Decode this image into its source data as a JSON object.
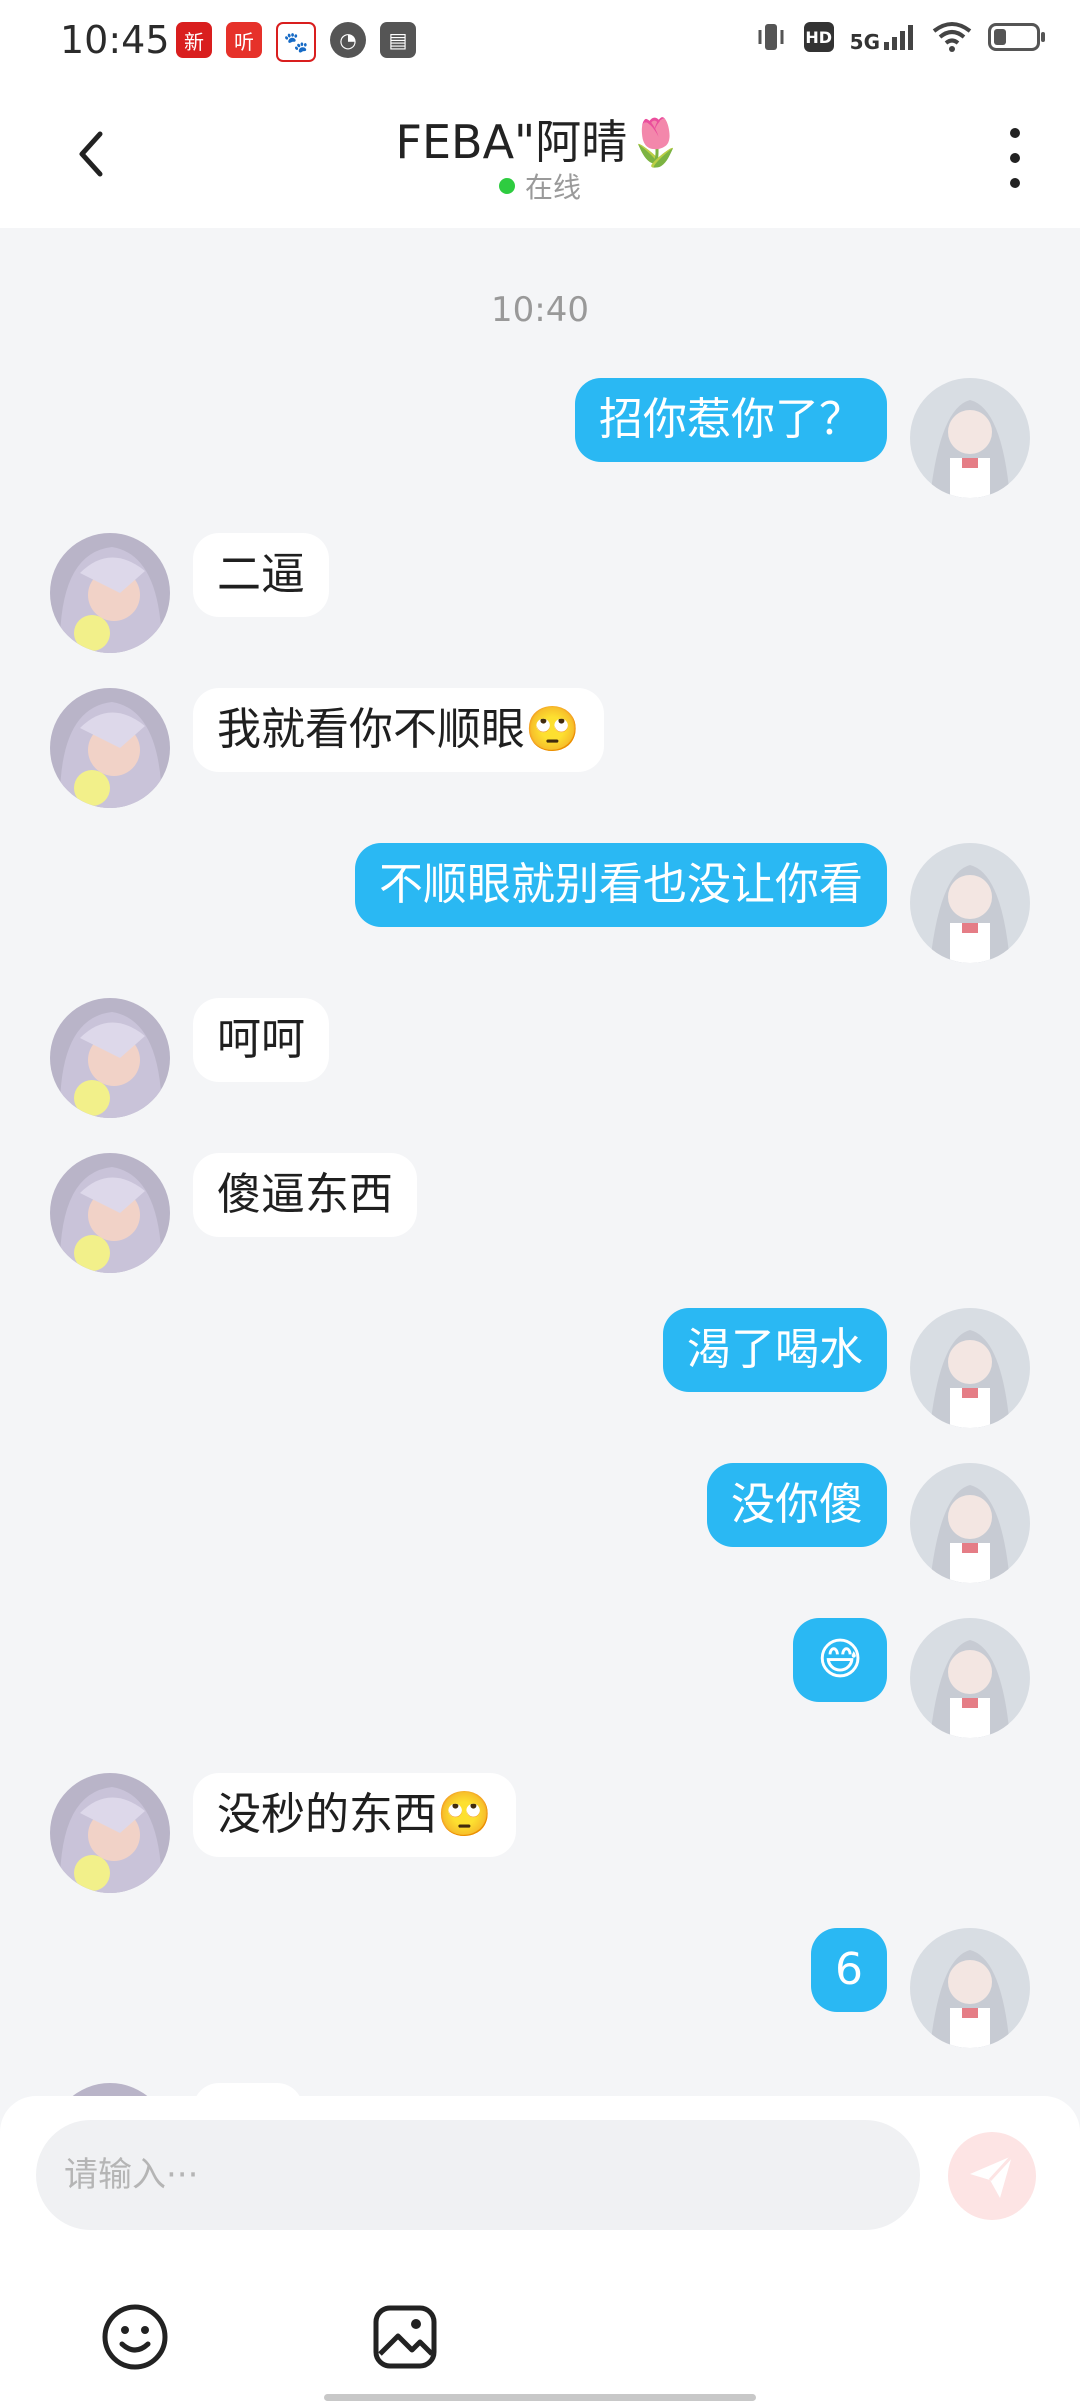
{
  "status_bar": {
    "time": "10:45",
    "app_icons": [
      {
        "name": "news-app-icon",
        "glyph": "新",
        "color": "#d91e1e"
      },
      {
        "name": "listen-app-icon",
        "glyph": "听",
        "color": "#e6312a"
      },
      {
        "name": "baidu-app-icon",
        "glyph": "🐾",
        "color": "#ffffff"
      },
      {
        "name": "speed-app-icon",
        "glyph": "◔",
        "color": "#555555"
      },
      {
        "name": "wallet-app-icon",
        "glyph": "▤",
        "color": "#555555"
      }
    ],
    "network_badge": "HD",
    "network_type": "5G"
  },
  "header": {
    "title": "FEBA\"阿晴🌷",
    "presence": "在线"
  },
  "chat": {
    "timestamp": "10:40",
    "messages": [
      {
        "side": "right",
        "text": "招你惹你了？"
      },
      {
        "side": "left",
        "text": "二逼"
      },
      {
        "side": "left",
        "text": "我就看你不顺眼🙄"
      },
      {
        "side": "right",
        "text": "不顺眼就别看也没让你看"
      },
      {
        "side": "left",
        "text": "呵呵"
      },
      {
        "side": "left",
        "text": "傻逼东西"
      },
      {
        "side": "right",
        "text": "渴了喝水"
      },
      {
        "side": "right",
        "text": "没你傻"
      },
      {
        "side": "right",
        "text": "😅"
      },
      {
        "side": "left",
        "text": "没秒的东西🙄"
      },
      {
        "side": "right",
        "text": "6"
      }
    ]
  },
  "composer": {
    "placeholder": "请输入···"
  },
  "colors": {
    "accent": "#2ab8f3",
    "incoming_bubble": "#ffffff",
    "background": "#f4f5f7",
    "online": "#2ecc40",
    "send_disabled": "#fde4e4"
  }
}
